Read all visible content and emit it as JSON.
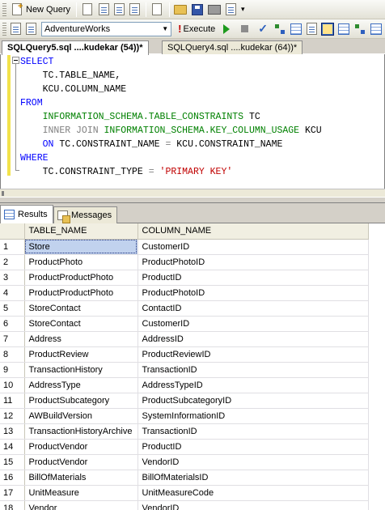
{
  "toolbar1": {
    "new_query_label": "New Query"
  },
  "toolbar2": {
    "database": "AdventureWorks",
    "execute_label": "Execute"
  },
  "editor_tabs": [
    {
      "label": "SQLQuery5.sql ....kudekar (54))*",
      "active": true
    },
    {
      "label": "SQLQuery4.sql ....kudekar (64))*",
      "active": false
    }
  ],
  "code_lines": [
    [
      {
        "t": "SELECT",
        "c": "kw"
      }
    ],
    [
      {
        "t": "    TC.TABLE_NAME,",
        "c": ""
      }
    ],
    [
      {
        "t": "    KCU.COLUMN_NAME",
        "c": ""
      }
    ],
    [
      {
        "t": "FROM",
        "c": "kw"
      }
    ],
    [
      {
        "t": "    ",
        "c": ""
      },
      {
        "t": "INFORMATION_SCHEMA.TABLE_CONSTRAINTS",
        "c": "fn"
      },
      {
        "t": " TC",
        "c": ""
      }
    ],
    [
      {
        "t": "    ",
        "c": ""
      },
      {
        "t": "INNER JOIN",
        "c": "gray"
      },
      {
        "t": " ",
        "c": ""
      },
      {
        "t": "INFORMATION_SCHEMA.KEY_COLUMN_USAGE",
        "c": "fn"
      },
      {
        "t": " KCU",
        "c": ""
      }
    ],
    [
      {
        "t": "    ",
        "c": ""
      },
      {
        "t": "ON",
        "c": "kw"
      },
      {
        "t": " TC.CONSTRAINT_NAME ",
        "c": ""
      },
      {
        "t": "=",
        "c": "gray"
      },
      {
        "t": " KCU.CONSTRAINT_NAME",
        "c": ""
      }
    ],
    [
      {
        "t": "WHERE",
        "c": "kw"
      }
    ],
    [
      {
        "t": "    TC.CONSTRAINT_TYPE ",
        "c": ""
      },
      {
        "t": "=",
        "c": "gray"
      },
      {
        "t": " ",
        "c": ""
      },
      {
        "t": "'PRIMARY KEY'",
        "c": "str"
      }
    ]
  ],
  "result_tabs": {
    "results_label": "Results",
    "messages_label": "Messages"
  },
  "grid": {
    "columns": [
      "TABLE_NAME",
      "COLUMN_NAME"
    ],
    "rows": [
      [
        "1",
        "Store",
        "CustomerID"
      ],
      [
        "2",
        "ProductPhoto",
        "ProductPhotoID"
      ],
      [
        "3",
        "ProductProductPhoto",
        "ProductID"
      ],
      [
        "4",
        "ProductProductPhoto",
        "ProductPhotoID"
      ],
      [
        "5",
        "StoreContact",
        "ContactID"
      ],
      [
        "6",
        "StoreContact",
        "CustomerID"
      ],
      [
        "7",
        "Address",
        "AddressID"
      ],
      [
        "8",
        "ProductReview",
        "ProductReviewID"
      ],
      [
        "9",
        "TransactionHistory",
        "TransactionID"
      ],
      [
        "10",
        "AddressType",
        "AddressTypeID"
      ],
      [
        "11",
        "ProductSubcategory",
        "ProductSubcategoryID"
      ],
      [
        "12",
        "AWBuildVersion",
        "SystemInformationID"
      ],
      [
        "13",
        "TransactionHistoryArchive",
        "TransactionID"
      ],
      [
        "14",
        "ProductVendor",
        "ProductID"
      ],
      [
        "15",
        "ProductVendor",
        "VendorID"
      ],
      [
        "16",
        "BillOfMaterials",
        "BillOfMaterialsID"
      ],
      [
        "17",
        "UnitMeasure",
        "UnitMeasureCode"
      ],
      [
        "18",
        "Vendor",
        "VendorID"
      ]
    ]
  }
}
